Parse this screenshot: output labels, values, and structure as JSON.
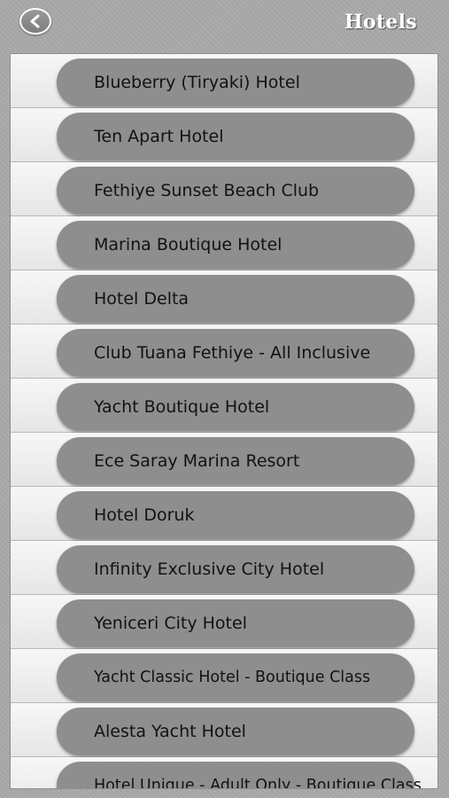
{
  "header": {
    "title": "Hotels",
    "back_icon": "back-arrow-icon"
  },
  "hotels": [
    "Blueberry (Tiryaki) Hotel",
    "Ten Apart Hotel",
    "Fethiye Sunset Beach Club",
    "Marina Boutique Hotel",
    "Hotel Delta",
    "Club Tuana Fethiye - All Inclusive",
    "Yacht Boutique Hotel",
    "Ece Saray Marina Resort",
    "Hotel Doruk",
    "Infinity Exclusive City Hotel",
    "Yeniceri City Hotel",
    "Yacht Classic Hotel - Boutique Class",
    "Alesta Yacht Hotel",
    "Hotel Unique - Adult Only - Boutique Class"
  ]
}
